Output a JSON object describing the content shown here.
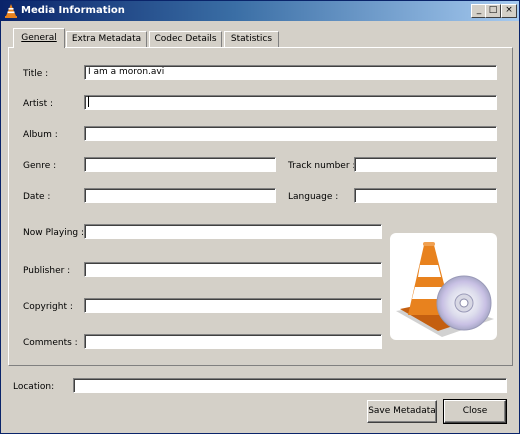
{
  "window": {
    "title": "Media Information",
    "minimize": "_",
    "maximize": "□",
    "close": "×"
  },
  "tabs": [
    {
      "label": "General",
      "active": true
    },
    {
      "label": "Extra Metadata",
      "active": false
    },
    {
      "label": "Codec Details",
      "active": false
    },
    {
      "label": "Statistics",
      "active": false
    }
  ],
  "general": {
    "title_label": "Title :",
    "title_value": "I am a moron.avi",
    "artist_label": "Artist :",
    "artist_value": "",
    "album_label": "Album :",
    "album_value": "",
    "genre_label": "Genre :",
    "genre_value": "",
    "track_label": "Track number :",
    "track_value": "",
    "date_label": "Date :",
    "date_value": "",
    "language_label": "Language :",
    "language_value": "",
    "now_playing_label": "Now Playing :",
    "now_playing_value": "",
    "publisher_label": "Publisher :",
    "publisher_value": "",
    "copyright_label": "Copyright :",
    "copyright_value": "",
    "comments_label": "Comments :",
    "comments_value": "",
    "art_icon": "vlc-cone-cd-icon"
  },
  "footer": {
    "location_label": "Location:",
    "location_value": "",
    "save_label": "Save Metadata",
    "close_label": "Close"
  },
  "colors": {
    "titlebar_start": "#0a246a",
    "titlebar_end": "#a6caf0",
    "face": "#d4d0c8",
    "cone_orange": "#e8821e"
  }
}
